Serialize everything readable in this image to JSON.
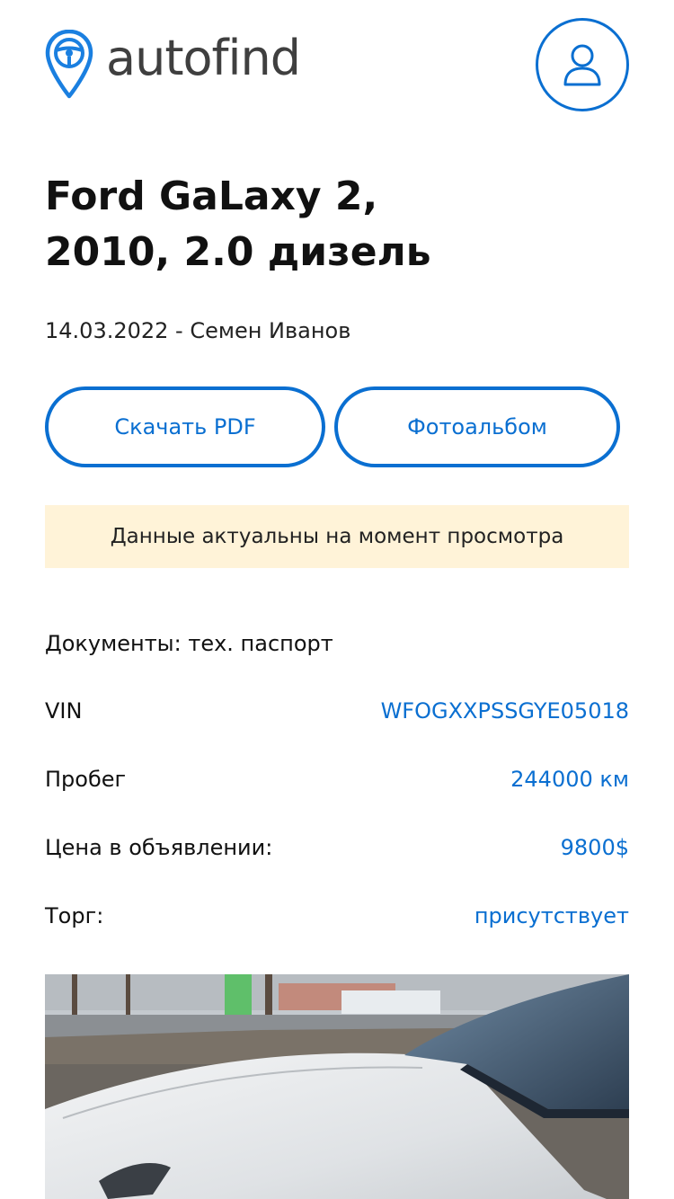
{
  "header": {
    "logo_text": "autofind"
  },
  "car": {
    "title_line1": "Ford GaLaxy 2,",
    "title_line2": "2010, 2.0 дизель",
    "meta": "14.03.2022 - Семен Иванов"
  },
  "actions": {
    "pdf_label": "Скачать PDF",
    "album_label": "Фотоальбом"
  },
  "notice": {
    "text": "Данные актуальны на момент просмотра"
  },
  "details": {
    "documents": "Документы: тех. паспорт",
    "vin_label": "VIN",
    "vin_value": "WFOGXXPSSGYE05018",
    "mileage_label": "Пробег",
    "mileage_value": "244000 км",
    "price_label": "Цена в объявлении:",
    "price_value": "9800$",
    "bargain_label": "Торг:",
    "bargain_value": "присутствует"
  },
  "colors": {
    "accent": "#0a6fd1",
    "notice_bg": "#fff3d8",
    "text": "#111111"
  },
  "icons": {
    "logo": "location-pin-steering-wheel-icon",
    "profile": "user-icon"
  }
}
